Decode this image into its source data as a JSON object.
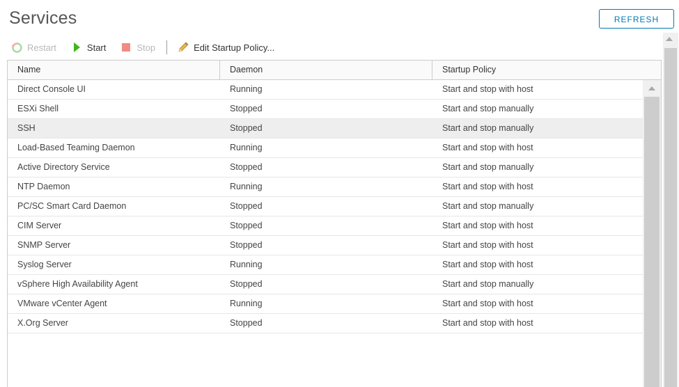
{
  "page": {
    "title": "Services",
    "refresh_label": "REFRESH"
  },
  "toolbar": {
    "restart_label": "Restart",
    "start_label": "Start",
    "stop_label": "Stop",
    "edit_policy_label": "Edit Startup Policy..."
  },
  "table": {
    "columns": [
      "Name",
      "Daemon",
      "Startup Policy"
    ],
    "rows": [
      {
        "name": "Direct Console UI",
        "daemon": "Running",
        "policy": "Start and stop with host"
      },
      {
        "name": "ESXi Shell",
        "daemon": "Stopped",
        "policy": "Start and stop manually"
      },
      {
        "name": "SSH",
        "daemon": "Stopped",
        "policy": "Start and stop manually"
      },
      {
        "name": "Load-Based Teaming Daemon",
        "daemon": "Running",
        "policy": "Start and stop with host"
      },
      {
        "name": "Active Directory Service",
        "daemon": "Stopped",
        "policy": "Start and stop manually"
      },
      {
        "name": "NTP Daemon",
        "daemon": "Running",
        "policy": "Start and stop with host"
      },
      {
        "name": "PC/SC Smart Card Daemon",
        "daemon": "Stopped",
        "policy": "Start and stop manually"
      },
      {
        "name": "CIM Server",
        "daemon": "Stopped",
        "policy": "Start and stop with host"
      },
      {
        "name": "SNMP Server",
        "daemon": "Stopped",
        "policy": "Start and stop with host"
      },
      {
        "name": "Syslog Server",
        "daemon": "Running",
        "policy": "Start and stop with host"
      },
      {
        "name": "vSphere High Availability Agent",
        "daemon": "Stopped",
        "policy": "Start and stop manually"
      },
      {
        "name": "VMware vCenter Agent",
        "daemon": "Running",
        "policy": "Start and stop with host"
      },
      {
        "name": "X.Org Server",
        "daemon": "Stopped",
        "policy": "Start and stop with host"
      }
    ]
  },
  "selected_row": "SSH",
  "colors": {
    "accent": "#0079b8",
    "start_icon": "#3fb618",
    "stop_icon": "#f28b82",
    "selected_row_bg": "#eeeeee"
  },
  "icons": {
    "restart": "restart-icon",
    "start": "play-icon",
    "stop": "stop-icon",
    "edit": "pencil-icon"
  }
}
